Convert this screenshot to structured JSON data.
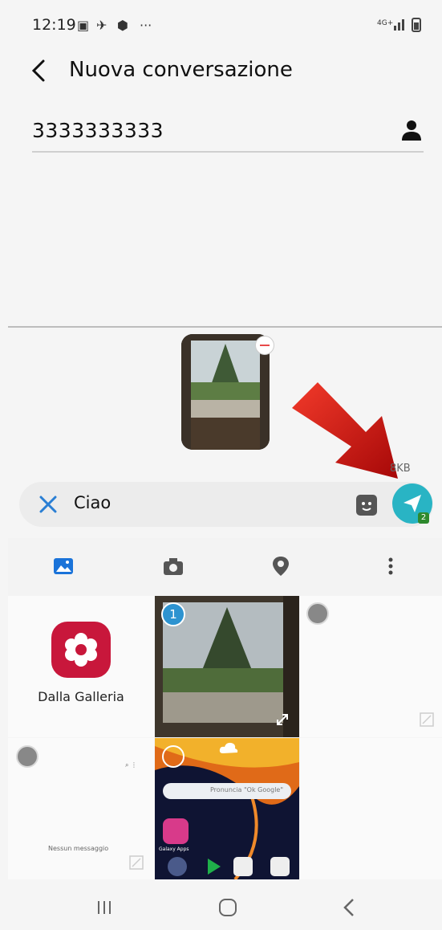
{
  "status_bar": {
    "time": "12:19",
    "more": "···",
    "signal_text": "4G+"
  },
  "header": {
    "title": "Nuova conversazione"
  },
  "recipient": {
    "value": "3333333333"
  },
  "attachment": {
    "size": "8KB"
  },
  "composer": {
    "message": "Ciao",
    "send_badge": "2"
  },
  "grid": {
    "gallery_label": "Dalla Galleria",
    "selected_index": "1",
    "screenshot_text": "Nessun messaggio",
    "search_hint": "Pronuncia \"Ok Google\"",
    "app_label": "Galaxy Apps"
  },
  "colors": {
    "send": "#29b4c4",
    "selected_badge": "#2d93d0",
    "gallery_icon": "#c8173b",
    "arrow": "#d61414"
  },
  "icons": [
    "back-arrow-icon",
    "contact-icon",
    "close-icon",
    "sticker-icon",
    "send-icon",
    "gallery-icon",
    "camera-icon",
    "location-icon",
    "more-icon",
    "expand-icon",
    "recent-apps-icon",
    "home-icon",
    "nav-back-icon"
  ]
}
